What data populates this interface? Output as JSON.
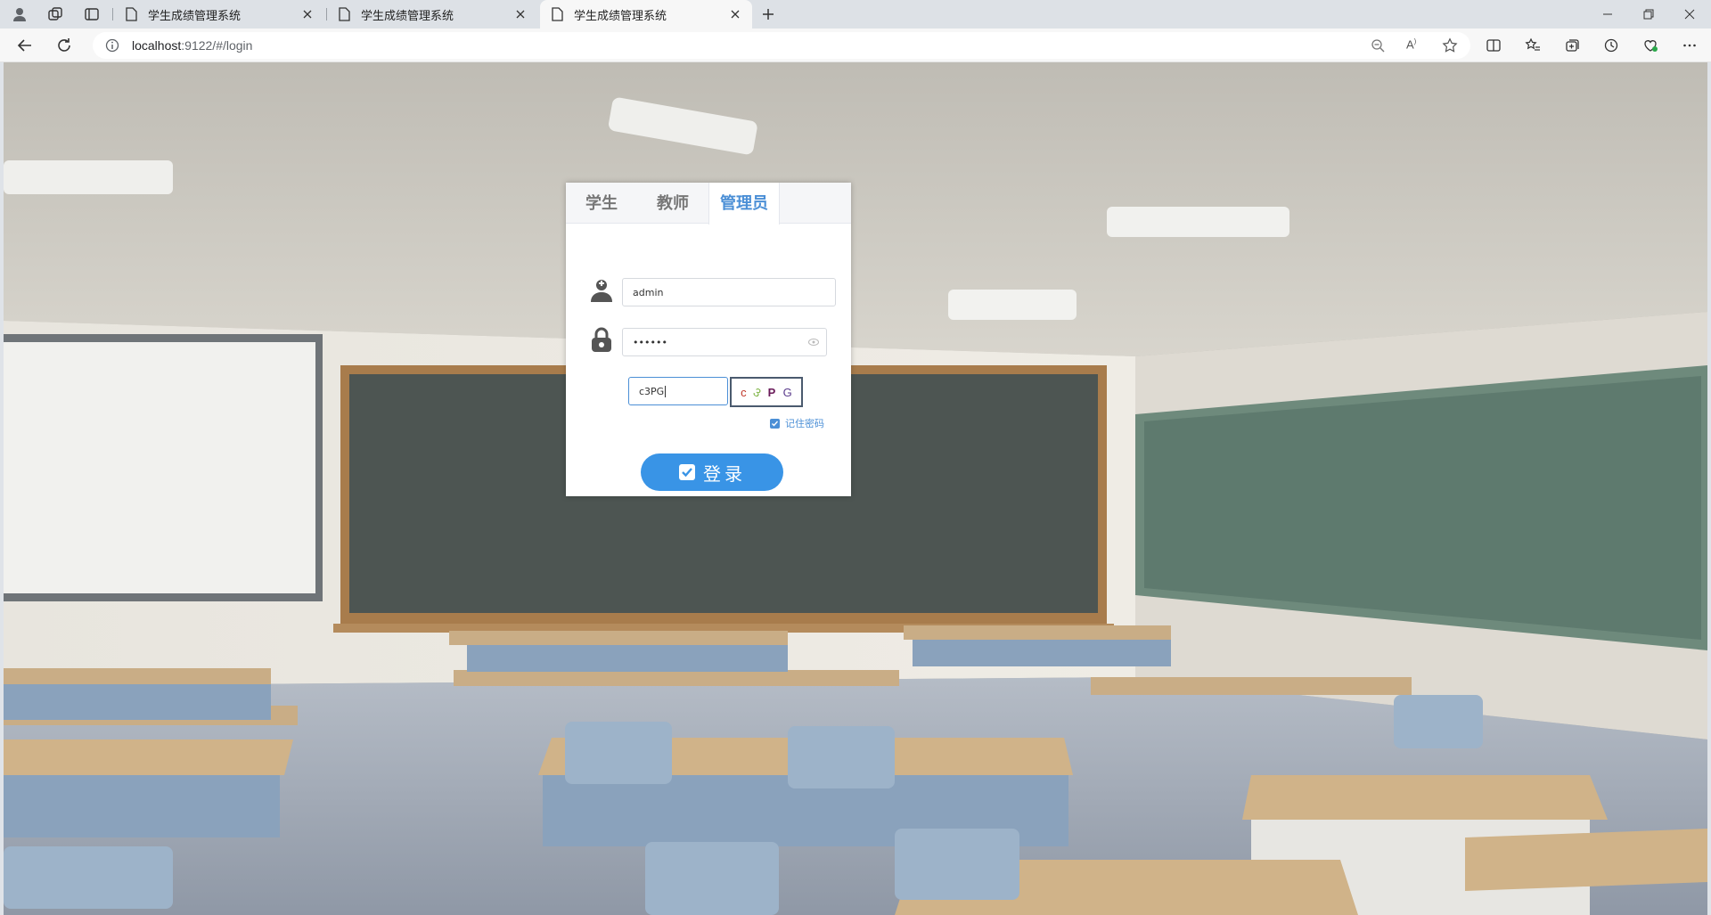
{
  "browser": {
    "tabs": [
      {
        "title": "学生成绩管理系统",
        "active": false
      },
      {
        "title": "学生成绩管理系统",
        "active": false
      },
      {
        "title": "学生成绩管理系统",
        "active": true
      }
    ],
    "url_host": "localhost",
    "url_rest": ":9122/#/login"
  },
  "login": {
    "role_tabs": [
      {
        "label": "学生",
        "active": false
      },
      {
        "label": "教师",
        "active": false
      },
      {
        "label": "管理员",
        "active": true
      }
    ],
    "username_value": "admin",
    "password_value": "••••••",
    "captcha_input_value": "c3PG",
    "captcha_chars": [
      "c",
      "3",
      "P",
      "G"
    ],
    "remember_label": "记住密码",
    "remember_checked": true,
    "submit_label": "登录"
  },
  "colors": {
    "accent": "#3994e6",
    "tab_active_text": "#4b8fd6"
  }
}
